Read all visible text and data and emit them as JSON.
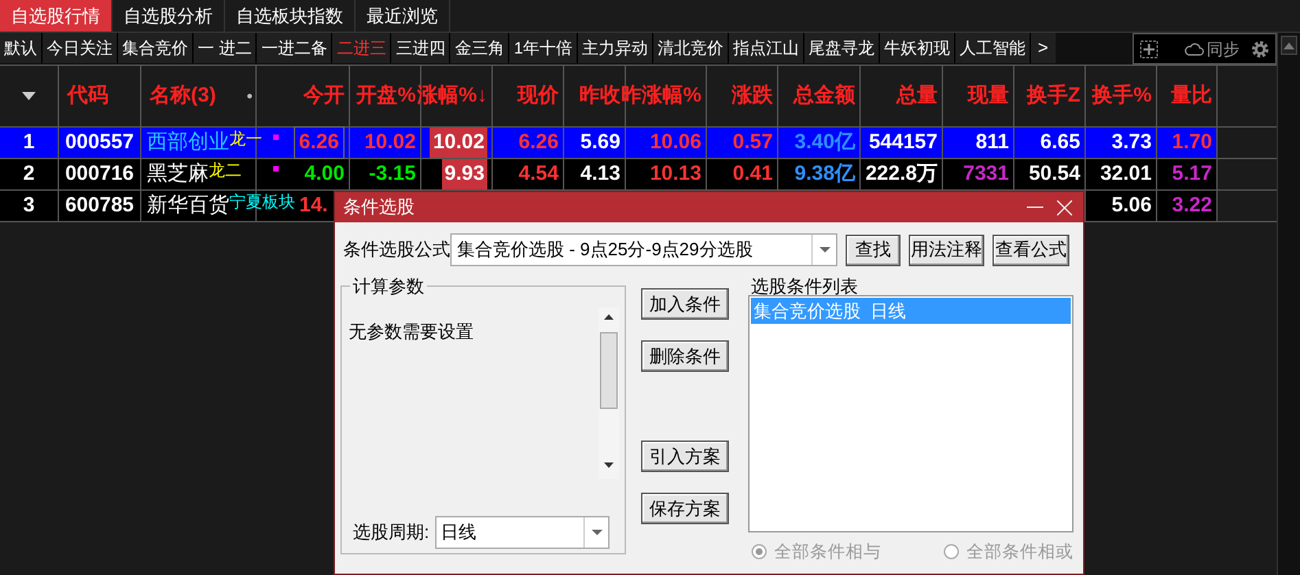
{
  "top_tabs": [
    {
      "label": "自选股行情",
      "selected": true
    },
    {
      "label": "自选股分析",
      "selected": false
    },
    {
      "label": "自选板块指数",
      "selected": false
    },
    {
      "label": "最近浏览",
      "selected": false
    }
  ],
  "sub_tabs": [
    {
      "label": "默认",
      "selected": false
    },
    {
      "label": "今日关注",
      "selected": false
    },
    {
      "label": "集合竞价",
      "selected": false
    },
    {
      "label": "一 进二",
      "selected": false
    },
    {
      "label": "一进二备",
      "selected": false
    },
    {
      "label": "二进三",
      "selected": true
    },
    {
      "label": "三进四",
      "selected": false
    },
    {
      "label": "金三角",
      "selected": false
    },
    {
      "label": "1年十倍",
      "selected": false
    },
    {
      "label": "主力异动",
      "selected": false
    },
    {
      "label": "清北竞价",
      "selected": false
    },
    {
      "label": "指点江山",
      "selected": false
    },
    {
      "label": "尾盘寻龙",
      "selected": false
    },
    {
      "label": "牛妖初现",
      "selected": false
    },
    {
      "label": "人工智能",
      "selected": false
    }
  ],
  "more_tabs": ">",
  "sync": "同步",
  "table": {
    "columns": [
      {
        "label": "代码"
      },
      {
        "label": "名称(3)",
        "extra": "•"
      },
      {
        "label": "今开"
      },
      {
        "label": "开盘%"
      },
      {
        "label": "涨幅%↓"
      },
      {
        "label": "现价"
      },
      {
        "label": "昨收"
      },
      {
        "label": "昨涨幅%"
      },
      {
        "label": "涨跌"
      },
      {
        "label": "总金额"
      },
      {
        "label": "总量"
      },
      {
        "label": "现量"
      },
      {
        "label": "换手Z"
      },
      {
        "label": "换手%"
      },
      {
        "label": "量比"
      }
    ],
    "rows": [
      {
        "index": "1",
        "selected": true,
        "cells": [
          {
            "text": "000557",
            "kind": "plain"
          },
          {
            "text": "西部创业",
            "kind": "cyan",
            "tag": {
              "text": "龙一",
              "color": "#ffff00"
            },
            "marker": true
          },
          {
            "text": "6.26",
            "kind": "up",
            "boxed": true
          },
          {
            "text": "10.02",
            "kind": "up"
          },
          {
            "text": "10.02",
            "kind": "plain",
            "highlight": true
          },
          {
            "text": "6.26",
            "kind": "up"
          },
          {
            "text": "5.69",
            "kind": "plain"
          },
          {
            "text": "10.06",
            "kind": "up"
          },
          {
            "text": "0.57",
            "kind": "up"
          },
          {
            "text": "3.40亿",
            "kind": "blue"
          },
          {
            "text": "544157",
            "kind": "plain"
          },
          {
            "text": "811",
            "kind": "plain"
          },
          {
            "text": "6.65",
            "kind": "plain"
          },
          {
            "text": "3.73",
            "kind": "plain"
          },
          {
            "text": "1.70",
            "kind": "up"
          }
        ]
      },
      {
        "index": "2",
        "selected": false,
        "cells": [
          {
            "text": "000716",
            "kind": "plain"
          },
          {
            "text": "黑芝麻",
            "kind": "plain",
            "tag": {
              "text": "龙二",
              "color": "#ffff00"
            },
            "marker": true
          },
          {
            "text": "4.00",
            "kind": "down"
          },
          {
            "text": "-3.15",
            "kind": "down"
          },
          {
            "text": "9.93",
            "kind": "plain",
            "highlight": true
          },
          {
            "text": "4.54",
            "kind": "up"
          },
          {
            "text": "4.13",
            "kind": "plain"
          },
          {
            "text": "10.13",
            "kind": "up"
          },
          {
            "text": "0.41",
            "kind": "up"
          },
          {
            "text": "9.38亿",
            "kind": "blue"
          },
          {
            "text": "222.8万",
            "kind": "plain"
          },
          {
            "text": "7331",
            "kind": "magenta"
          },
          {
            "text": "50.54",
            "kind": "plain"
          },
          {
            "text": "32.01",
            "kind": "plain"
          },
          {
            "text": "5.17",
            "kind": "magenta"
          }
        ]
      },
      {
        "index": "3",
        "selected": false,
        "cells": [
          {
            "text": "600785",
            "kind": "plain"
          },
          {
            "text": "新华百货",
            "kind": "plain",
            "tag": {
              "text": "宁夏板块",
              "color": "#00ffff"
            },
            "marker": false
          },
          {
            "text": "14.",
            "kind": "up",
            "clipped": true
          },
          null,
          null,
          null,
          null,
          null,
          null,
          null,
          null,
          null,
          null,
          {
            "text": "5.06",
            "kind": "plain"
          },
          {
            "text": "3.22",
            "kind": "magenta"
          }
        ]
      }
    ]
  },
  "dialog": {
    "title": "条件选股",
    "formula_label": "条件选股公式",
    "formula": "集合竞价选股 - 9点25分-9点29分选股",
    "top_buttons": [
      "查找",
      "用法注释",
      "查看公式"
    ],
    "params_group": "计算参数",
    "params_text": "无参数需要设置",
    "period_label": "选股周期:",
    "period": "日线",
    "middle_buttons": [
      "加入条件",
      "删除条件",
      "引入方案",
      "保存方案"
    ],
    "list_label": "选股条件列表",
    "list_items": [
      {
        "label": "集合竞价选股  日线",
        "selected": true
      }
    ],
    "radios": [
      {
        "label": "全部条件相与",
        "checked": true,
        "disabled": true
      },
      {
        "label": "全部条件相或",
        "checked": false,
        "disabled": true
      }
    ]
  }
}
